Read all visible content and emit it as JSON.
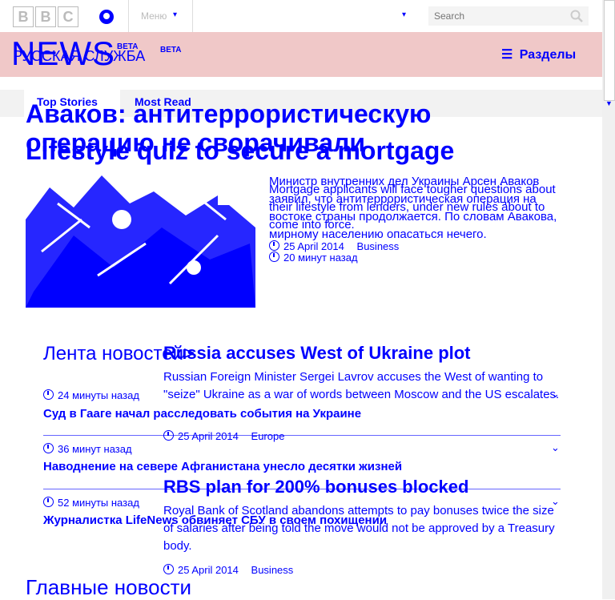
{
  "header": {
    "brand": [
      "B",
      "B",
      "C"
    ],
    "menu_label": "Меню",
    "caret": "▾",
    "search_placeholder": "Search"
  },
  "newsband": {
    "news": "NEWS",
    "service": "РУССКАЯ СЛУЖБА",
    "beta": "BETA",
    "sections": "Разделы"
  },
  "tabs": [
    "Top Stories",
    "Most Read"
  ],
  "lead_story_ru": {
    "headline": "Аваков: антитеррористическую операцию не сворачивали",
    "summary": "Министр внутренних дел Украины Арсен Аваков заявил, что антитеррористическая операция на востоке страны продолжается. По словам Авакова, мирному населению опасаться нечего.",
    "time": "20 минут назад"
  },
  "lead_story_en": {
    "headline": "Lifestyle quiz to secure a mortgage",
    "summary": "Mortgage applicants will face tougher questions about their lifestyle from lenders, under new rules about to come into force.",
    "date": "25 April 2014",
    "section": "Business"
  },
  "feed": {
    "title": "Лента новостей",
    "items": [
      {
        "time": "24 минуты назад",
        "headline": "Суд в Гааге начал расследовать события на Украине"
      },
      {
        "time": "36 минут назад",
        "headline": "Наводнение на севере Афганистана унесло десятки жизней"
      },
      {
        "time": "52 минуты назад",
        "headline": "Журналистка LifeNews обвиняет СБУ в своем похищении"
      }
    ]
  },
  "stories_en": [
    {
      "headline": "Russia accuses West of Ukraine plot",
      "summary": "Russian Foreign Minister Sergei Lavrov accuses the West of wanting to \"seize\" Ukraine as a war of words between Moscow and the US escalates.",
      "date": "25 April 2014",
      "section": "Europe"
    },
    {
      "headline": "RBS plan for 200% bonuses blocked",
      "summary": "Royal Bank of Scotland abandons attempts to pay bonuses twice the size of salaries after being told the move would not be approved by a Treasury body.",
      "date": "25 April 2014",
      "section": "Business"
    }
  ],
  "main_news_title": "Главные новости",
  "colors": {
    "accent": "#0000ff",
    "band": "#f0c8c8"
  }
}
